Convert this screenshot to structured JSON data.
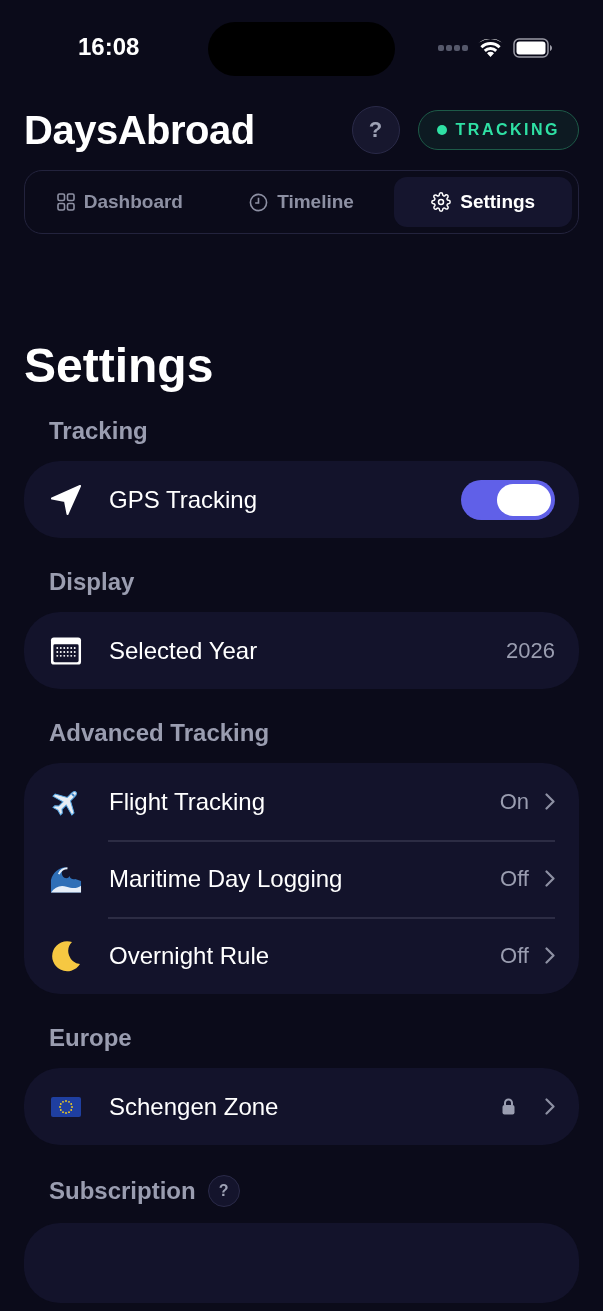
{
  "status_bar": {
    "time": "16:08"
  },
  "header": {
    "title": "DaysAbroad",
    "help_button": "?",
    "status_badge": {
      "label": "TRACKING",
      "active": true
    }
  },
  "tabs": [
    {
      "label": "Dashboard",
      "selected": false
    },
    {
      "label": "Timeline",
      "selected": false
    },
    {
      "label": "Settings",
      "selected": true
    }
  ],
  "page_title": "Settings",
  "sections": [
    {
      "title": "Tracking",
      "rows": [
        {
          "kind": "toggle",
          "label": "GPS Tracking",
          "on": true
        }
      ]
    },
    {
      "title": "Display",
      "rows": [
        {
          "kind": "value",
          "label": "Selected Year",
          "value": "2026"
        }
      ]
    },
    {
      "title": "Advanced Tracking",
      "rows": [
        {
          "kind": "link",
          "label": "Flight Tracking",
          "value": "On"
        },
        {
          "kind": "link",
          "label": "Maritime Day Logging",
          "value": "Off"
        },
        {
          "kind": "link",
          "label": "Overnight Rule",
          "value": "Off"
        }
      ]
    },
    {
      "title": "Europe",
      "rows": [
        {
          "kind": "link",
          "label": "Schengen Zone",
          "locked": true
        }
      ]
    },
    {
      "title": "Subscription",
      "help_button": "?"
    }
  ]
}
